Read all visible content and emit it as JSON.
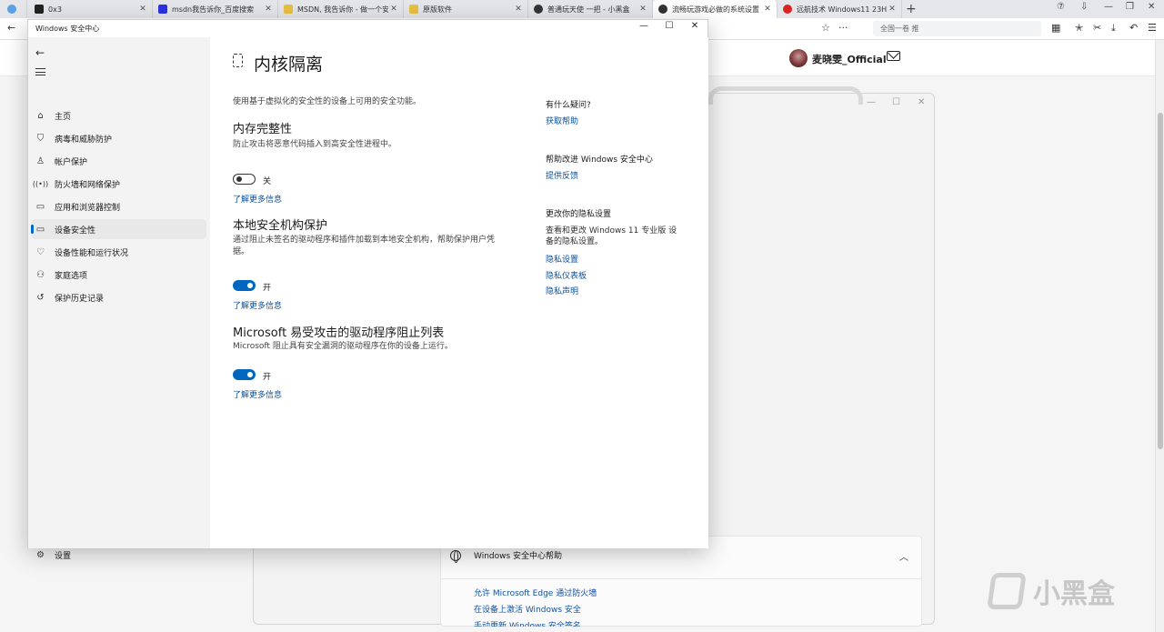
{
  "browser": {
    "tabs": [
      {
        "title": "0x3",
        "favicon": "0x3"
      },
      {
        "title": "msdn我告诉你_百度搜索",
        "favicon": "baidu"
      },
      {
        "title": "MSDN, 我告诉你 - 做一个安",
        "favicon": "msdn"
      },
      {
        "title": "原版软件",
        "favicon": "msdn"
      },
      {
        "title": "普通玩天使 一把 - 小黑盒",
        "favicon": "xiaoheihe"
      },
      {
        "title": "流畅玩游戏必做的系统设置",
        "favicon": "xiaoheihe"
      },
      {
        "title": "远航技术 Windows11 23H2",
        "favicon": "red"
      }
    ],
    "address_text": "全国一卷 推",
    "overflow_menu": "···"
  },
  "page": {
    "user_name": "麦晓雯_Official"
  },
  "bg_window": {
    "help_title": "Windows 安全中心帮助",
    "help_links": [
      "允许 Microsoft Edge 通过防火墙",
      "在设备上激活 Windows 安全",
      "手动更新 Windows 安全签名"
    ]
  },
  "watermark": {
    "text": "小黑盒"
  },
  "security_window": {
    "title": "Windows 安全中心",
    "nav": [
      {
        "label": "主页",
        "icon": "home-icon"
      },
      {
        "label": "病毒和威胁防护",
        "icon": "shield-icon"
      },
      {
        "label": "帐户保护",
        "icon": "person-icon"
      },
      {
        "label": "防火墙和网络保护",
        "icon": "wifi-icon"
      },
      {
        "label": "应用和浏览器控制",
        "icon": "app-window-icon"
      },
      {
        "label": "设备安全性",
        "icon": "laptop-icon"
      },
      {
        "label": "设备性能和运行状况",
        "icon": "heart-icon"
      },
      {
        "label": "家庭选项",
        "icon": "family-icon"
      },
      {
        "label": "保护历史记录",
        "icon": "history-icon"
      }
    ],
    "settings_label": "设置",
    "main": {
      "title": "内核隔离",
      "description": "使用基于虚拟化的安全性的设备上可用的安全功能。",
      "sections": [
        {
          "heading": "内存完整性",
          "description": "防止攻击将恶意代码插入到高安全性进程中。",
          "toggle_state": "关",
          "toggle_on": false,
          "link": "了解更多信息"
        },
        {
          "heading": "本地安全机构保护",
          "description": "通过阻止未签名的驱动程序和插件加载到本地安全机构，帮助保护用户凭据。",
          "toggle_state": "开",
          "toggle_on": true,
          "link": "了解更多信息"
        },
        {
          "heading": "Microsoft 易受攻击的驱动程序阻止列表",
          "description": "Microsoft 阻止具有安全漏洞的驱动程序在你的设备上运行。",
          "toggle_state": "开",
          "toggle_on": true,
          "link": "了解更多信息"
        }
      ]
    },
    "side": {
      "questions_head": "有什么疑问?",
      "get_help": "获取帮助",
      "improve_head": "帮助改进 Windows 安全中心",
      "feedback": "提供反馈",
      "privacy_head": "更改你的隐私设置",
      "privacy_text": "查看和更改 Windows 11 专业版 设备的隐私设置。",
      "privacy_links": [
        "隐私设置",
        "隐私仪表板",
        "隐私声明"
      ]
    }
  },
  "colors": {
    "accent": "#0067c0",
    "link": "#0a4f9c"
  }
}
